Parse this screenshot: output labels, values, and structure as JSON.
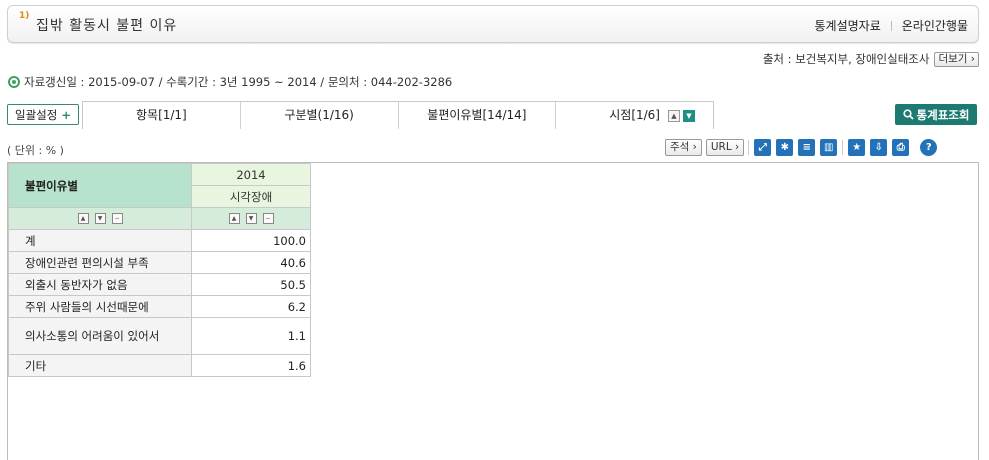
{
  "header": {
    "number": "1)",
    "title": "집밖 활동시 불편 이유",
    "links": [
      "통계설명자료",
      "온라인간행물"
    ]
  },
  "source": {
    "label": "출처 : 보건복지부, 장애인실태조사",
    "more": "더보기"
  },
  "info": "자료갱신일 : 2015-09-07 / 수록기간 : 3년 1995 ~ 2014 / 문의처 : 044-202-3286",
  "bulk_button": "일괄설정",
  "tabs": [
    "항목[1/1]",
    "구분별(1/16)",
    "불편이유별[14/14]",
    "시점[1/6]"
  ],
  "stats_button": "통계표조회",
  "unit": "( 단위 : % )",
  "toolbar": {
    "note": "주석",
    "url": "URL"
  },
  "table": {
    "row_header": "불편이유별",
    "year": "2014",
    "column": "시각장애",
    "rows": [
      {
        "label": "계",
        "value": "100.0"
      },
      {
        "label": "장애인관련 편의시설 부족",
        "value": "40.6"
      },
      {
        "label": "외출시 동반자가 없음",
        "value": "50.5"
      },
      {
        "label": "주위 사람들의 시선때문에",
        "value": "6.2"
      },
      {
        "label": "의사소통의 어려움이 있어서",
        "value": "1.1"
      },
      {
        "label": "기타",
        "value": "1.6"
      }
    ]
  }
}
